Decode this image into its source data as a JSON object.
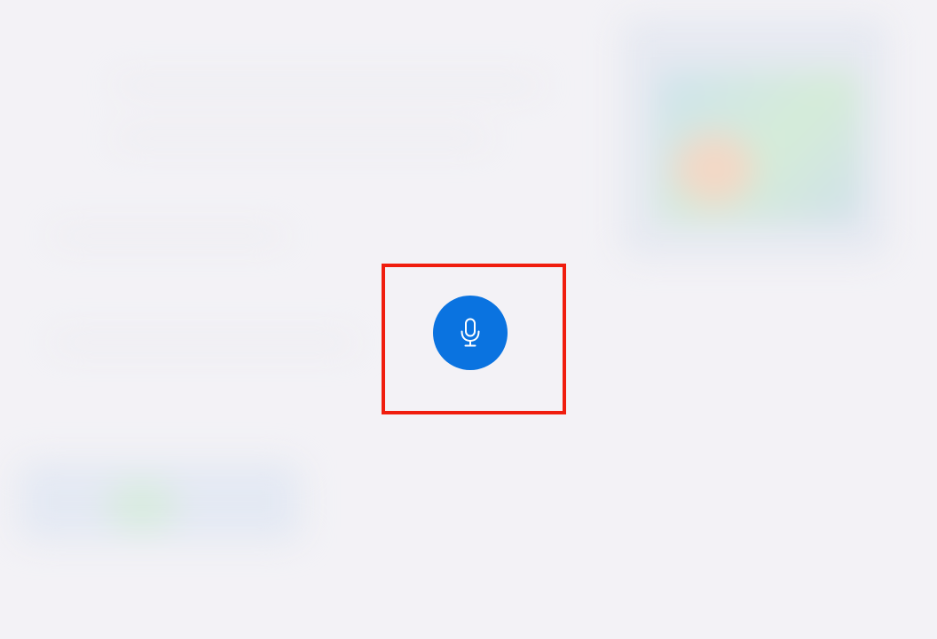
{
  "voice_button": {
    "icon": "microphone-icon",
    "color": "#0a73e0",
    "icon_color": "#ffffff"
  },
  "highlight": {
    "color": "#f01d0e"
  },
  "background": {
    "color": "#f3f2f6"
  }
}
